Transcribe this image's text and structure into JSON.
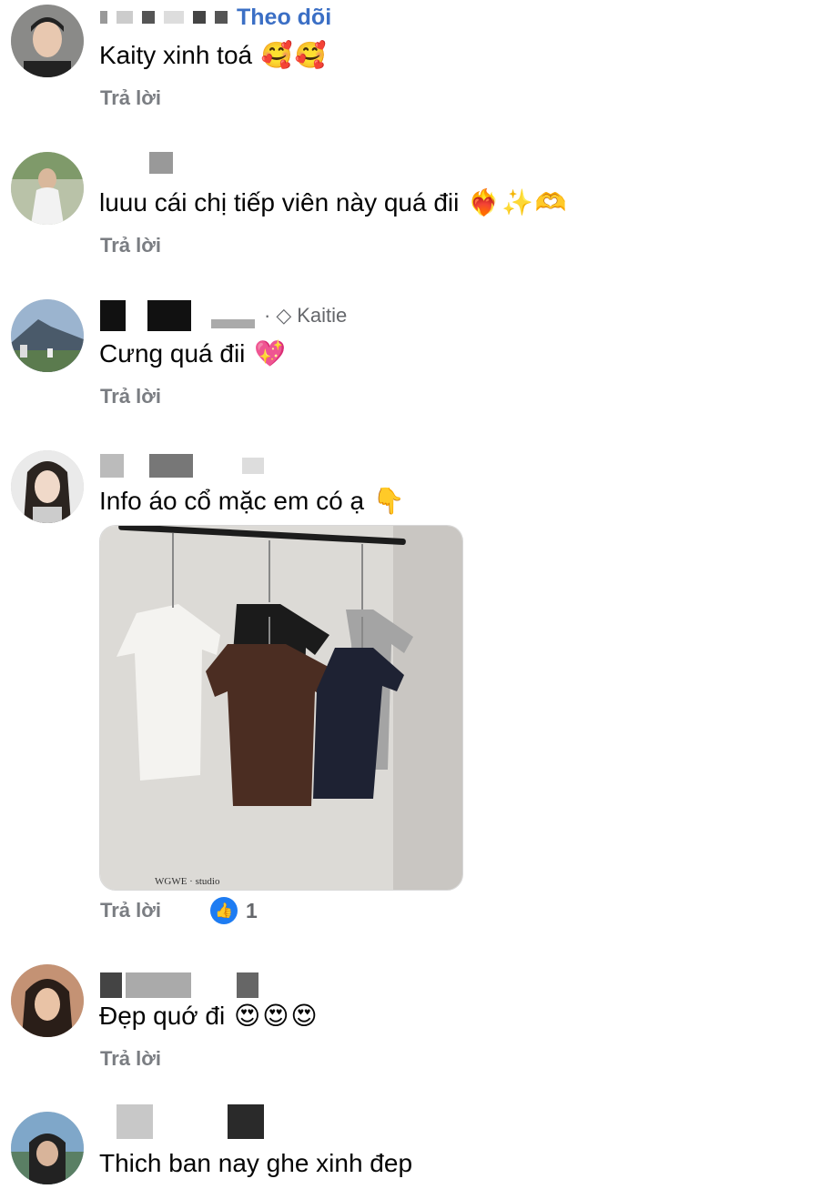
{
  "follow_label": "Theo dõi",
  "reply_label": "Trả lời",
  "comments": [
    {
      "text": "Kaity xinh toá",
      "emojis": [
        "🥰",
        "🥰"
      ]
    },
    {
      "text": "luuu cái chị tiếp viên này quá đii",
      "emojis": [
        "❤️‍🔥",
        "✨",
        "🫶"
      ]
    },
    {
      "text": "Cưng quá đii",
      "emojis": [
        "💖"
      ],
      "tag": "Kaitie",
      "tag_prefix": "·"
    },
    {
      "text": "Info áo cổ mặc em có ạ",
      "emojis": [
        "👇"
      ],
      "likes": "1",
      "image_watermark": "WGWE · studio"
    },
    {
      "text": "Đẹp quớ đi",
      "emojis": [
        "😍",
        "😍",
        "😍"
      ]
    },
    {
      "text": "Thich ban nay ghe xinh đep",
      "emojis": []
    }
  ],
  "colors": {
    "follow": "#3b6fc5",
    "reply": "#7a7d82",
    "like": "#1e7cf2"
  }
}
